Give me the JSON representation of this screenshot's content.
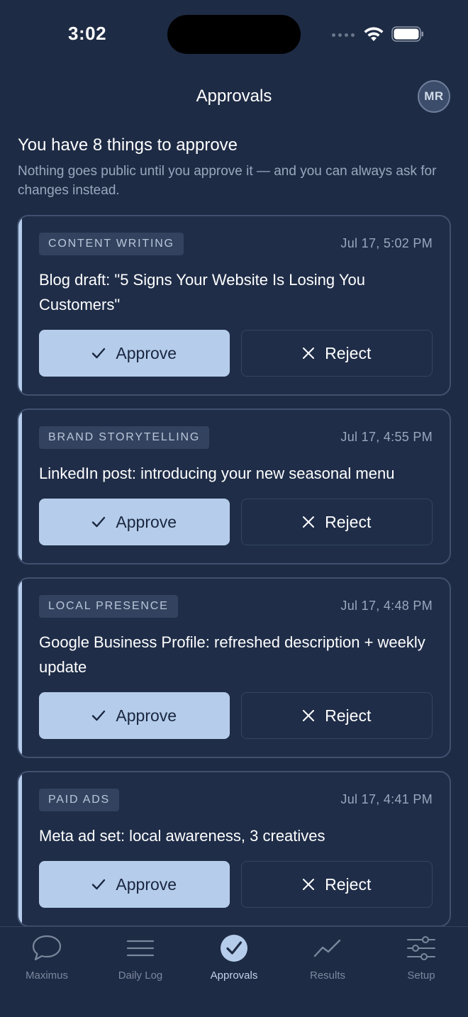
{
  "status_bar": {
    "time": "3:02"
  },
  "header": {
    "title": "Approvals",
    "avatar_initials": "MR"
  },
  "intro": {
    "heading": "You have 8 things to approve",
    "subtext": "Nothing goes public until you approve it — and you can always ask for changes instead."
  },
  "cards": [
    {
      "category": "CONTENT WRITING",
      "timestamp": "Jul 17, 5:02 PM",
      "title": "Blog draft: \"5 Signs Your Website Is Losing You Customers\"",
      "approve_label": "Approve",
      "reject_label": "Reject"
    },
    {
      "category": "BRAND STORYTELLING",
      "timestamp": "Jul 17, 4:55 PM",
      "title": "LinkedIn post: introducing your new seasonal menu",
      "approve_label": "Approve",
      "reject_label": "Reject"
    },
    {
      "category": "LOCAL PRESENCE",
      "timestamp": "Jul 17, 4:48 PM",
      "title": "Google Business Profile: refreshed description + weekly update",
      "approve_label": "Approve",
      "reject_label": "Reject"
    },
    {
      "category": "PAID ADS",
      "timestamp": "Jul 17, 4:41 PM",
      "title": "Meta ad set: local awareness, 3 creatives",
      "approve_label": "Approve",
      "reject_label": "Reject"
    }
  ],
  "tabs": [
    {
      "label": "Maximus",
      "icon": "chat-bubble-icon"
    },
    {
      "label": "Daily Log",
      "icon": "list-lines-icon"
    },
    {
      "label": "Approvals",
      "icon": "check-circle-icon",
      "active": true
    },
    {
      "label": "Results",
      "icon": "trend-line-icon"
    },
    {
      "label": "Setup",
      "icon": "sliders-icon"
    }
  ],
  "colors": {
    "background": "#1e2b45",
    "accent": "#b5cdea",
    "card_border": "#40506e"
  }
}
